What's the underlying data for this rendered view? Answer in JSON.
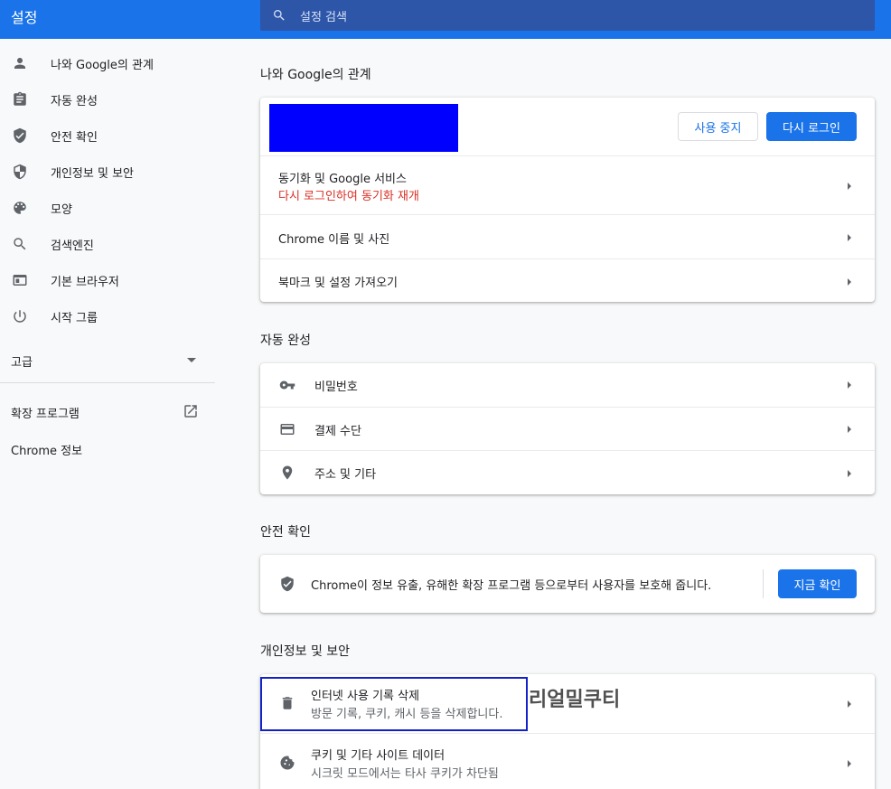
{
  "header": {
    "title": "설정",
    "search_placeholder": "설정 검색"
  },
  "sidebar": {
    "items": [
      {
        "label": "나와 Google의 관계",
        "icon": "person-icon"
      },
      {
        "label": "자동 완성",
        "icon": "clipboard-icon"
      },
      {
        "label": "안전 확인",
        "icon": "shield-check-icon"
      },
      {
        "label": "개인정보 및 보안",
        "icon": "shield-icon"
      },
      {
        "label": "모양",
        "icon": "palette-icon"
      },
      {
        "label": "검색엔진",
        "icon": "search-icon"
      },
      {
        "label": "기본 브라우저",
        "icon": "browser-icon"
      },
      {
        "label": "시작 그룹",
        "icon": "power-icon"
      }
    ],
    "advanced": "고급",
    "extensions": "확장 프로그램",
    "about": "Chrome 정보"
  },
  "sections": {
    "you_google": {
      "title": "나와 Google의 관계",
      "turn_off": "사용 중지",
      "sign_in_again": "다시 로그인",
      "sync_title": "동기화 및 Google 서비스",
      "sync_error": "다시 로그인하여 동기화 재개",
      "chrome_name": "Chrome 이름 및 사진",
      "import": "북마크 및 설정 가져오기"
    },
    "autofill": {
      "title": "자동 완성",
      "passwords": "비밀번호",
      "payments": "결제 수단",
      "addresses": "주소 및 기타"
    },
    "safety": {
      "title": "안전 확인",
      "description": "Chrome이 정보 유출, 유해한 확장 프로그램 등으로부터 사용자를 보호해 줍니다.",
      "check_now": "지금 확인"
    },
    "privacy": {
      "title": "개인정보 및 보안",
      "clear_title": "인터넷 사용 기록 삭제",
      "clear_sub": "방문 기록, 쿠키, 캐시 등을 삭제합니다.",
      "cookies_title": "쿠키 및 기타 사이트 데이터",
      "cookies_sub": "시크릿 모드에서는 타사 쿠키가 차단됨"
    }
  },
  "watermark": "리얼밀쿠티",
  "colors": {
    "accent": "#1a73e8",
    "error": "#d93025",
    "redacted": "#0000ff",
    "highlight": "#1222c8"
  }
}
